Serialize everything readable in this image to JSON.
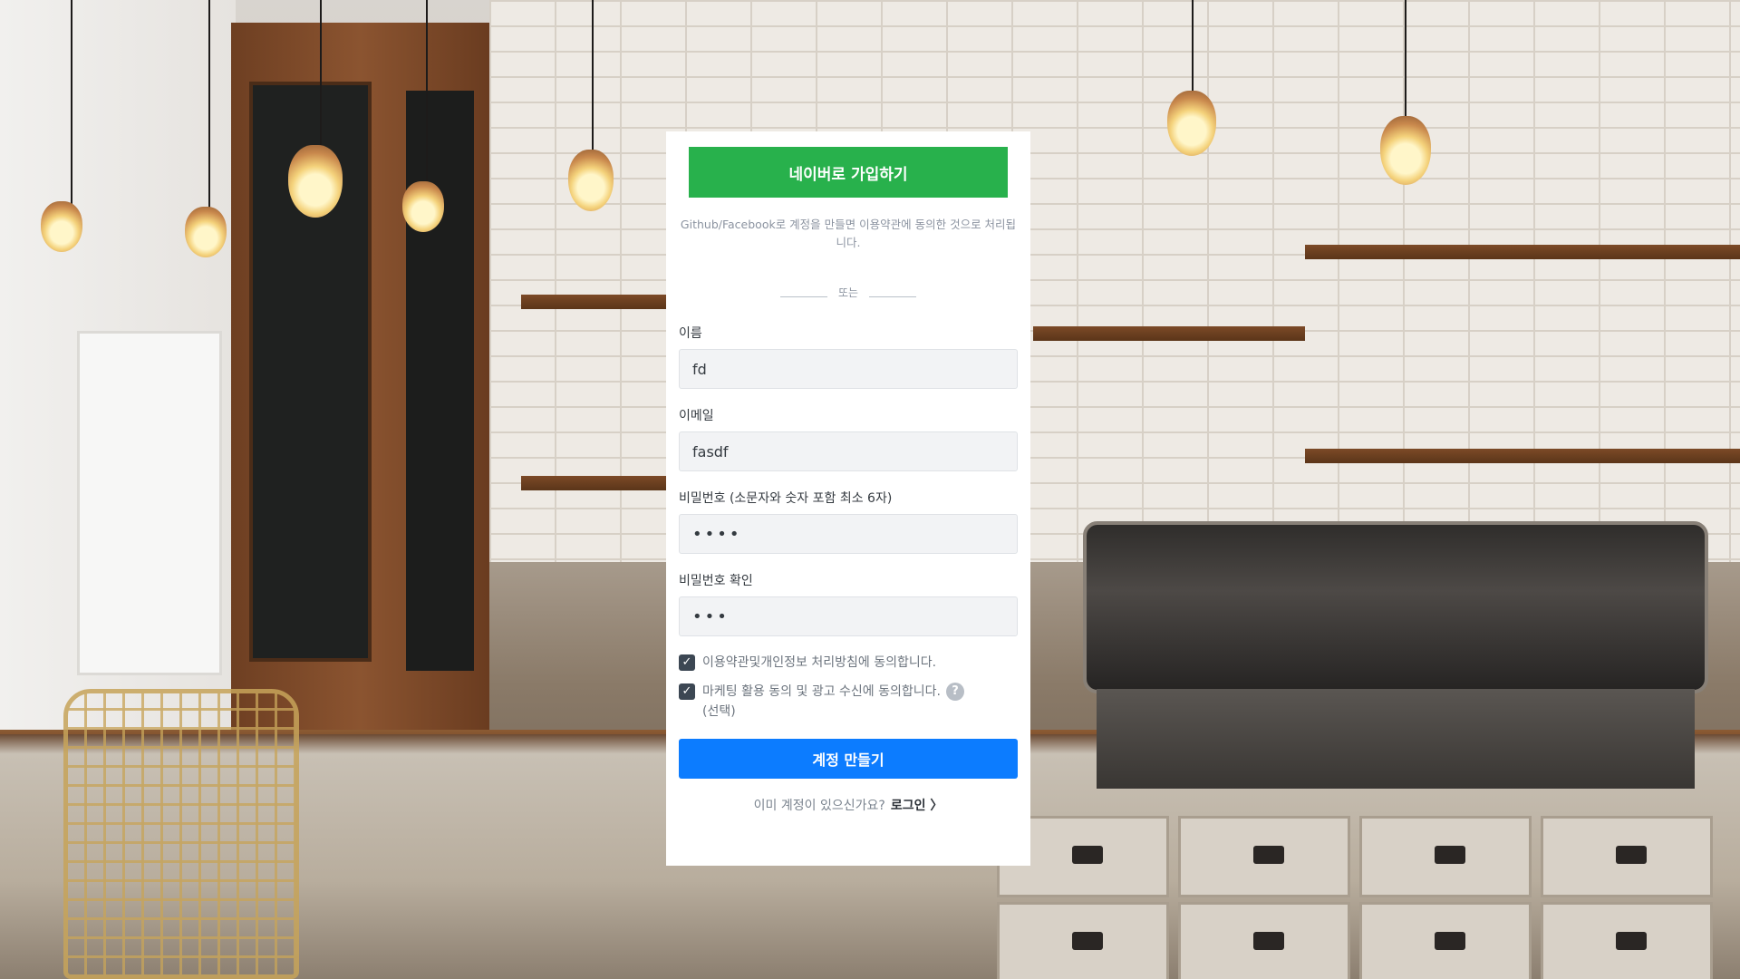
{
  "signup": {
    "naver_button": "네이버로 가입하기",
    "notice": "Github/Facebook로 계정을 만들면 이용약관에 동의한 것으로 처리됩니다.",
    "divider_text": "또는",
    "name_label": "이름",
    "name_value": "fd",
    "email_label": "이메일",
    "email_value": "fasdf",
    "password_label": "비밀번호 (소문자와 숫자 포함 최소 6자)",
    "password_mask": "••••",
    "password_confirm_label": "비밀번호 확인",
    "password_confirm_mask": "•••",
    "terms_checkbox": {
      "label": "이용약관및개인정보 처리방침에 동의합니다.",
      "checked": true
    },
    "marketing_checkbox": {
      "label": "마케팅 활용 동의 및 광고 수신에 동의합니다.",
      "optional_text": "(선택)",
      "checked": true
    },
    "help_icon": "question-circle-icon",
    "create_button": "계정 만들기",
    "login_prompt": "이미 계정이 있으신가요?",
    "login_link": "로그인 〉"
  },
  "colors": {
    "naver_green": "#28b14c",
    "primary_blue": "#0c7cff"
  }
}
